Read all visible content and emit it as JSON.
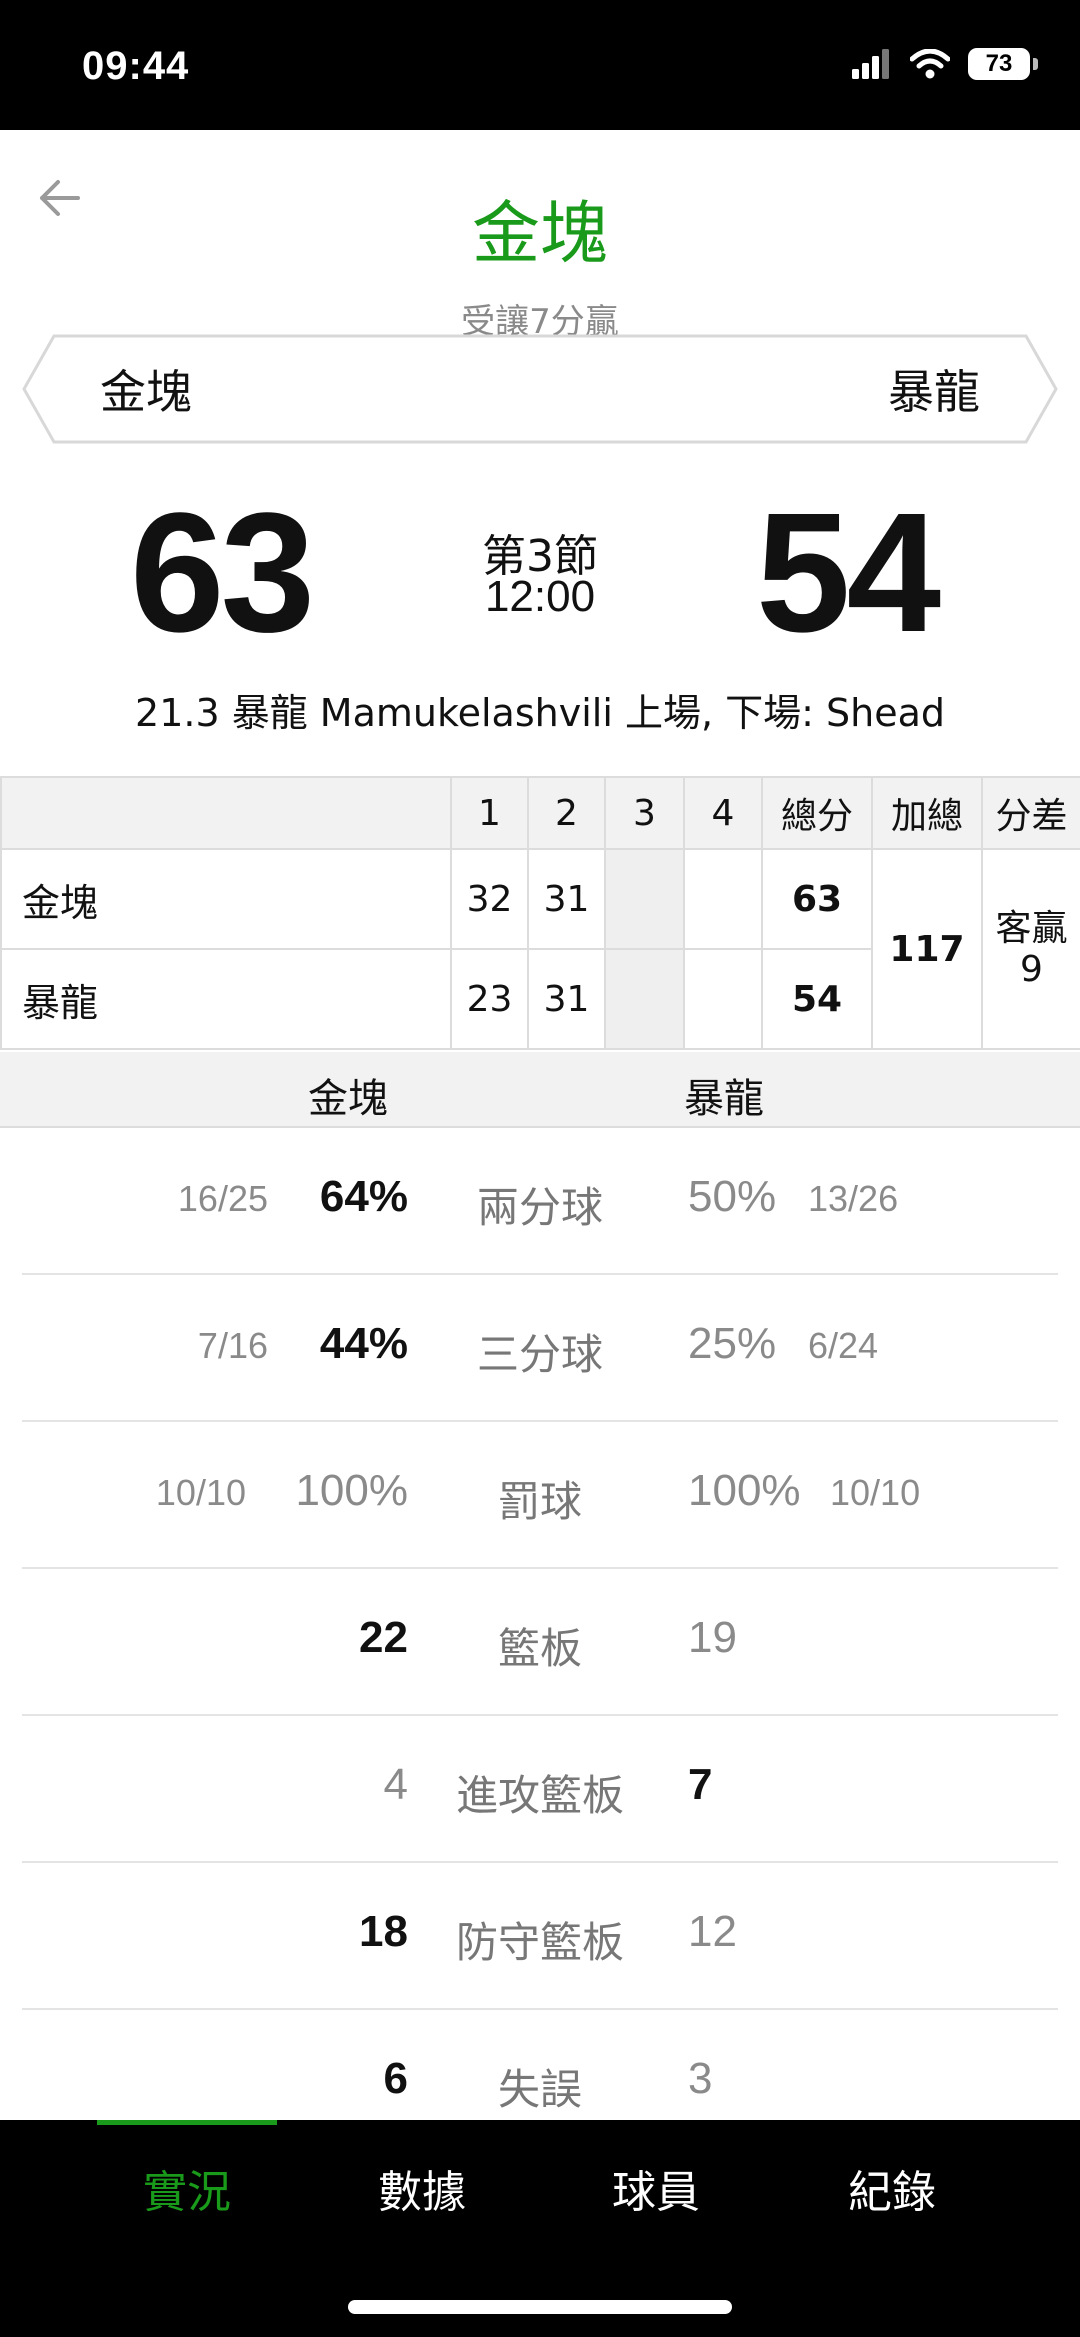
{
  "status_bar": {
    "time": "09:44",
    "battery": "73"
  },
  "header": {
    "title": "金塊",
    "subtitle": "受讓7分贏",
    "home_team": "金塊",
    "away_team": "暴龍"
  },
  "score": {
    "home": "63",
    "away": "54",
    "period": "第3節",
    "clock": "12:00",
    "event": "21.3 暴龍 Mamukelashvili 上場, 下場: Shead"
  },
  "box_score": {
    "headers": [
      "",
      "1",
      "2",
      "3",
      "4",
      "總分",
      "加總",
      "分差"
    ],
    "rows": [
      {
        "team": "金塊",
        "q1": "32",
        "q2": "31",
        "q3": "",
        "q4": "",
        "total": "63"
      },
      {
        "team": "暴龍",
        "q1": "23",
        "q2": "31",
        "q3": "",
        "q4": "",
        "total": "54"
      }
    ],
    "combined": "117",
    "diff_label": "客贏",
    "diff_value": "9"
  },
  "compare_header": {
    "home": "金塊",
    "away": "暴龍"
  },
  "stats": [
    {
      "label": "兩分球",
      "home_sub": "16/25",
      "home_val": "64%",
      "away_val": "50%",
      "away_sub": "13/26"
    },
    {
      "label": "三分球",
      "home_sub": "7/16",
      "home_val": "44%",
      "away_val": "25%",
      "away_sub": "6/24"
    },
    {
      "label": "罰球",
      "home_sub": "10/10",
      "home_val": "100%",
      "away_val": "100%",
      "away_sub": "10/10"
    },
    {
      "label": "籃板",
      "home_sub": "",
      "home_val": "22",
      "away_val": "19",
      "away_sub": ""
    },
    {
      "label": "進攻籃板",
      "home_sub": "",
      "home_val": "4",
      "away_val": "7",
      "away_sub": ""
    },
    {
      "label": "防守籃板",
      "home_sub": "",
      "home_val": "18",
      "away_val": "12",
      "away_sub": ""
    },
    {
      "label": "失誤",
      "home_sub": "",
      "home_val": "6",
      "away_val": "3",
      "away_sub": ""
    }
  ],
  "tabs": [
    {
      "label": "實況",
      "active": true
    },
    {
      "label": "數據",
      "active": false
    },
    {
      "label": "球員",
      "active": false
    },
    {
      "label": "紀錄",
      "active": false
    }
  ],
  "colors": {
    "accent": "#1a9a1a",
    "muted": "#8a8a8a",
    "bar": "#000000"
  }
}
